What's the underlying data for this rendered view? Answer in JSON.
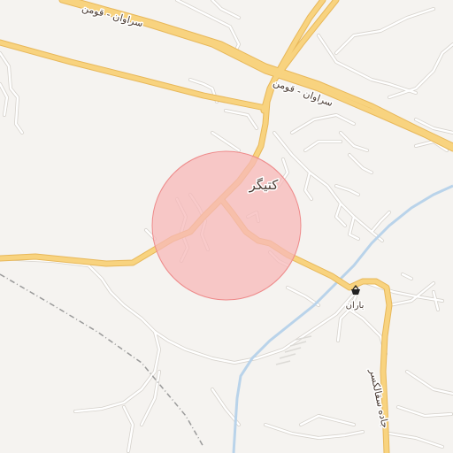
{
  "map": {
    "place_label": "کتیگر",
    "poi_label": "باران",
    "poi_icon": "shopping-basket-icon",
    "highway_label_1": "سراوان - قومن",
    "highway_label_2": "سراوان - قومن",
    "road_label": "جاده سقالکسر",
    "colors": {
      "background": "#f5f3f0",
      "major_road": "#f8d37f",
      "major_road_casing": "#e8b85a",
      "minor_road": "#ffffff",
      "minor_road_casing": "#d6d2cc",
      "railway": "#9a9a9a",
      "waterway": "#b9d3ea",
      "highlight_fill": "#f7b8b8",
      "highlight_stroke": "#ee8a8a"
    }
  }
}
